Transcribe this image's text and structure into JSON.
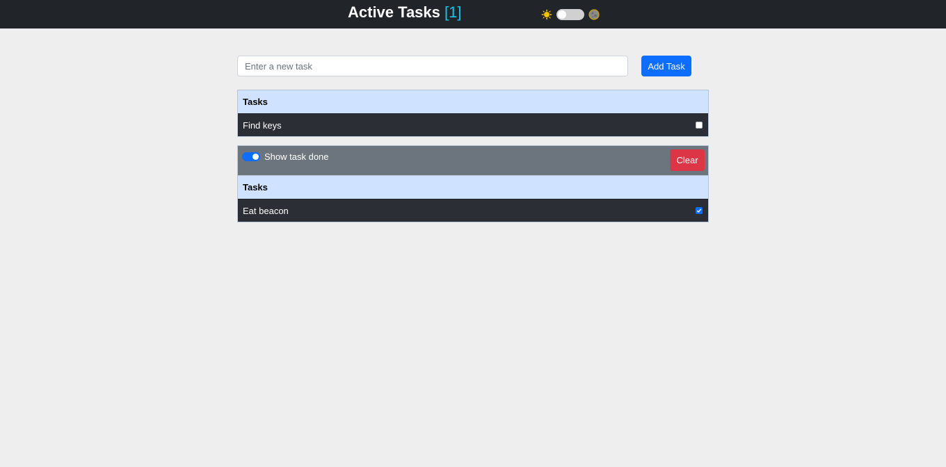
{
  "header": {
    "title": "Active Tasks",
    "count": "[1]",
    "theme_toggle": {
      "light_icon": "sun-icon",
      "dark_icon": "moon-icon",
      "state": "light"
    }
  },
  "form": {
    "placeholder": "Enter a new task",
    "value": "",
    "add_label": "Add Task"
  },
  "active_table": {
    "header": "Tasks",
    "rows": [
      {
        "label": "Find keys",
        "done": false
      }
    ]
  },
  "done_section": {
    "toggle_label": "Show task done",
    "toggle_on": true,
    "clear_label": "Clear",
    "table": {
      "header": "Tasks",
      "rows": [
        {
          "label": "Eat beacon",
          "done": true
        }
      ]
    }
  },
  "colors": {
    "accent": "#0d6efd",
    "danger": "#dc3545",
    "count": "#0dcaf0",
    "navbar": "#212529"
  }
}
